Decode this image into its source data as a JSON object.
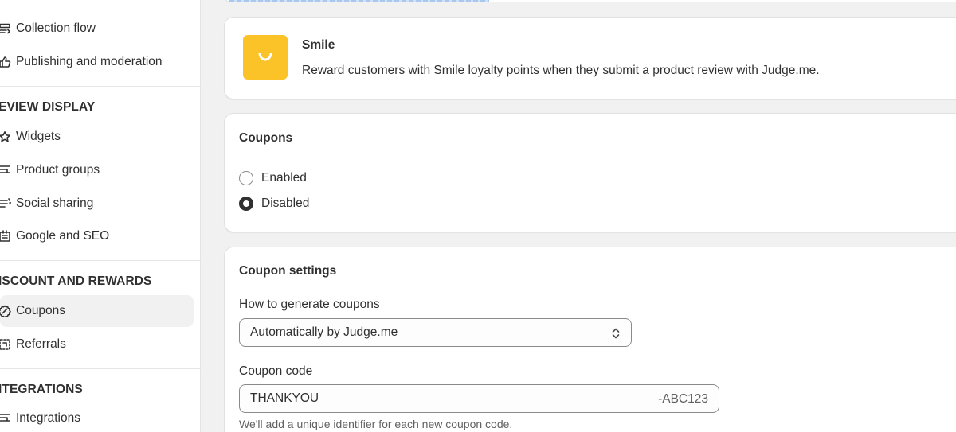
{
  "sidebar": {
    "items": [
      {
        "label": "Collection flow",
        "icon": "collection-flow-icon"
      },
      {
        "label": "Publishing and moderation",
        "icon": "thumbs-up-icon"
      },
      {
        "label": "Widgets",
        "icon": "star-icon"
      },
      {
        "label": "Product groups",
        "icon": "product-groups-icon"
      },
      {
        "label": "Social sharing",
        "icon": "social-sharing-icon"
      },
      {
        "label": "Google and SEO",
        "icon": "seo-icon"
      },
      {
        "label": "Coupons",
        "icon": "coupon-icon"
      },
      {
        "label": "Referrals",
        "icon": "referral-icon"
      },
      {
        "label": "Integrations",
        "icon": "integrations-icon"
      }
    ],
    "sections": {
      "review_display": "EVIEW DISPLAY",
      "discount_rewards": "ISCOUNT AND REWARDS",
      "integrations": "ITEGRATIONS"
    },
    "active_item": "Coupons"
  },
  "smile_card": {
    "name": "Smile",
    "description": "Reward customers with Smile loyalty points when they submit a product review with Judge.me.",
    "logo_color": "#fcc328"
  },
  "coupons_card": {
    "title": "Coupons",
    "options": [
      "Enabled",
      "Disabled"
    ],
    "selected": "Disabled"
  },
  "coupon_settings": {
    "title": "Coupon settings",
    "generate_label": "How to generate coupons",
    "generate_value": "Automatically by Judge.me",
    "code_label": "Coupon code",
    "code_value": "THANKYOU",
    "code_suffix": "-ABC123",
    "help_text": "We'll add a unique identifier for each new coupon code."
  }
}
